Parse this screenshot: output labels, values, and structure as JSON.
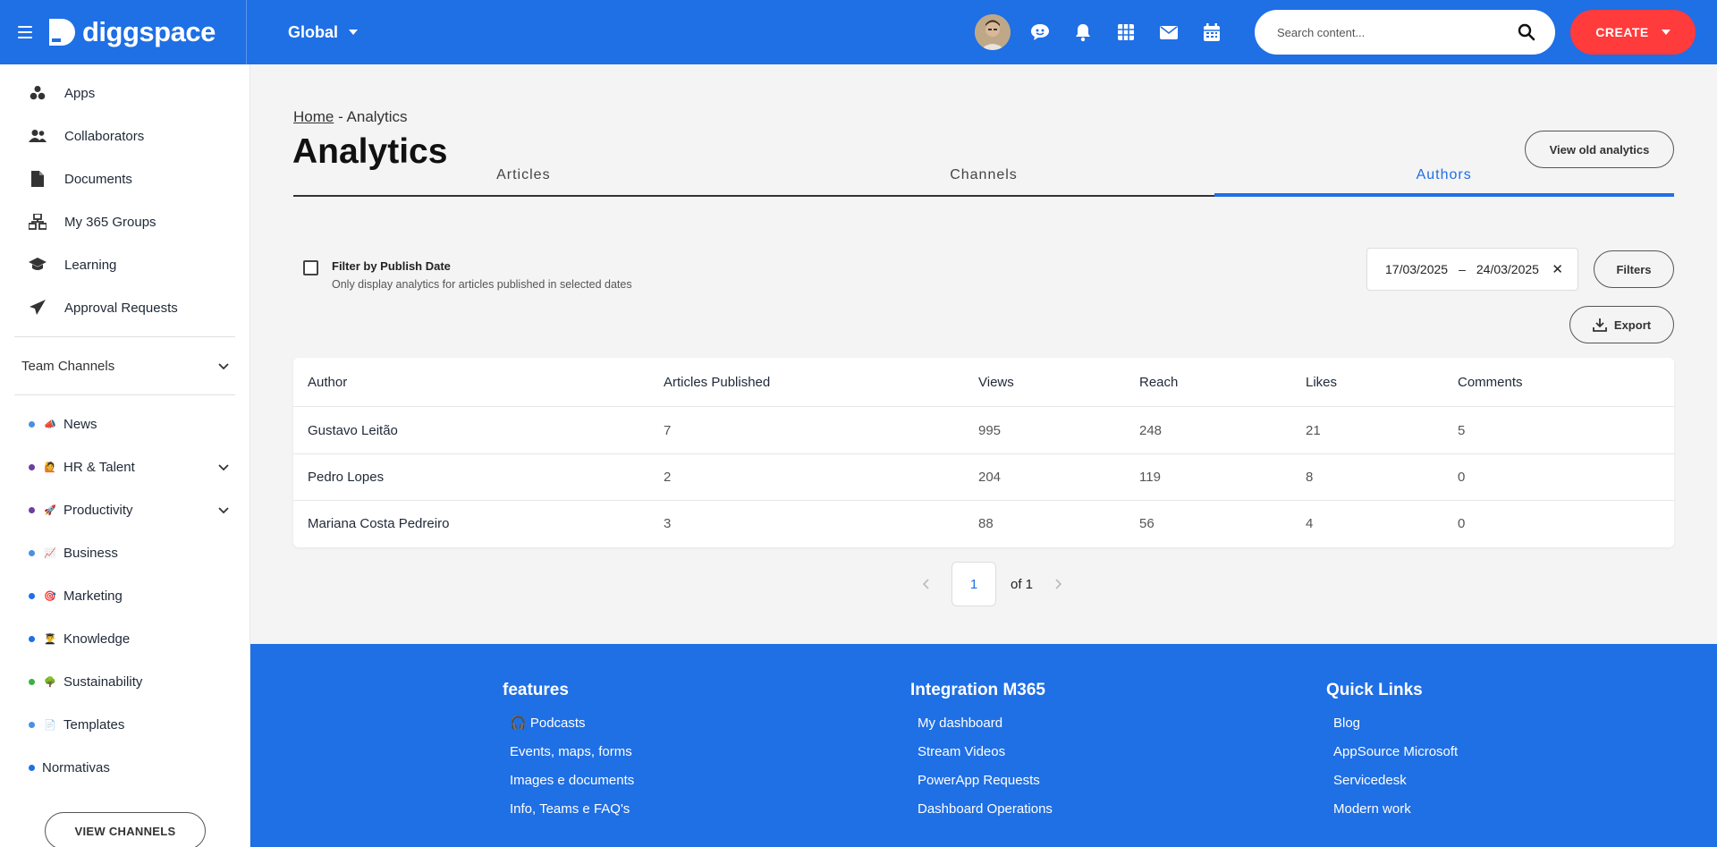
{
  "topbar": {
    "brand": "diggspace",
    "scope": "Global",
    "search_placeholder": "Search content...",
    "create_label": "CREATE",
    "icons": [
      "menu-icon",
      "chat-icon",
      "bell-icon",
      "grid-icon",
      "mail-icon",
      "calendar-icon",
      "search-icon"
    ]
  },
  "sidebar": {
    "nav": [
      {
        "label": "Apps",
        "icon": "apps-icon"
      },
      {
        "label": "Collaborators",
        "icon": "people-icon"
      },
      {
        "label": "Documents",
        "icon": "document-icon"
      },
      {
        "label": "My 365 Groups",
        "icon": "groups-icon"
      },
      {
        "label": "Learning",
        "icon": "graduation-cap-icon"
      },
      {
        "label": "Approval Requests",
        "icon": "paper-plane-icon"
      }
    ],
    "team_channels_label": "Team Channels",
    "channels": [
      {
        "label": "News",
        "emoji": "📣",
        "dot": "#4a90e2"
      },
      {
        "label": "HR & Talent",
        "emoji": "🙋",
        "dot": "#6b3fa0"
      },
      {
        "label": "Productivity",
        "emoji": "🚀",
        "dot": "#6b3fa0"
      },
      {
        "label": "Business",
        "emoji": "📈",
        "dot": "#4a90e2"
      },
      {
        "label": "Marketing",
        "emoji": "🎯",
        "dot": "#1f6fe5"
      },
      {
        "label": "Knowledge",
        "emoji": "👨‍🎓",
        "dot": "#1f6fe5"
      },
      {
        "label": "Sustainability",
        "emoji": "🌳",
        "dot": "#3cb043"
      },
      {
        "label": "Templates",
        "emoji": "📄",
        "dot": "#4a90e2"
      },
      {
        "label": "Normativas",
        "emoji": "",
        "dot": "#1f6fe5"
      }
    ],
    "view_channels_label": "VIEW CHANNELS"
  },
  "main": {
    "breadcrumb_home": "Home",
    "breadcrumb_sep": " - ",
    "breadcrumb_current": "Analytics",
    "title": "Analytics",
    "view_old_label": "View old analytics",
    "tabs": [
      "Articles",
      "Channels",
      "Authors"
    ],
    "active_tab": "Authors",
    "filter_title": "Filter by Publish Date",
    "filter_sub": "Only display analytics for articles published in selected dates",
    "date_from": "17/03/2025",
    "date_sep": "–",
    "date_to": "24/03/2025",
    "filters_label": "Filters",
    "export_label": "Export",
    "table": {
      "headers": [
        "Author",
        "Articles Published",
        "Views",
        "Reach",
        "Likes",
        "Comments"
      ],
      "rows": [
        [
          "Gustavo Leitão",
          "7",
          "995",
          "248",
          "21",
          "5"
        ],
        [
          "Pedro Lopes",
          "2",
          "204",
          "119",
          "8",
          "0"
        ],
        [
          "Mariana Costa Pedreiro",
          "3",
          "88",
          "56",
          "4",
          "0"
        ]
      ]
    },
    "pager": {
      "page": "1",
      "of": "of 1"
    }
  },
  "footer": {
    "columns": [
      {
        "title": "features",
        "links": [
          "🎧 Podcasts",
          "Events, maps, forms",
          "Images e documents",
          "Info, Teams e FAQ's"
        ]
      },
      {
        "title": "Integration M365",
        "links": [
          "My dashboard",
          "Stream Videos",
          "PowerApp Requests",
          "Dashboard Operations"
        ]
      },
      {
        "title": "Quick Links",
        "links": [
          "Blog",
          "AppSource Microsoft",
          "Servicedesk",
          "Modern work"
        ]
      }
    ]
  },
  "colors": {
    "primary": "#1f6fe5",
    "create": "#ff3b3b"
  }
}
